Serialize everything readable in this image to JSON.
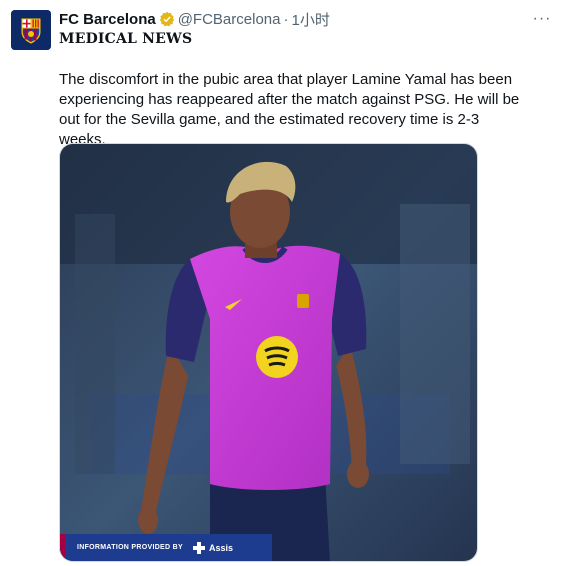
{
  "tweet": {
    "display_name": "FC Barcelona",
    "handle": "@FCBarcelona",
    "separator": "·",
    "time": "1小时",
    "more_label": "···",
    "headline": "MEDICAL NEWS",
    "text": "The discomfort in the pubic area that player Lamine Yamal has been experiencing has reappeared after the match against PSG. He will be out for the Sevilla game, and the estimated recovery time is 2-3 weeks."
  },
  "media": {
    "sponsor_label": "INFORMATION PROVIDED BY",
    "sponsor_brand": "Assis"
  },
  "icons": {
    "avatar": "fc-barcelona-crest",
    "verified": "verified-badge-gold",
    "more": "more-options-icon"
  },
  "colors": {
    "verified": "#e2b719",
    "club_blue": "#0d2a66",
    "club_red": "#a50044",
    "secondary_text": "#536471",
    "jersey": "#c93dd6"
  }
}
